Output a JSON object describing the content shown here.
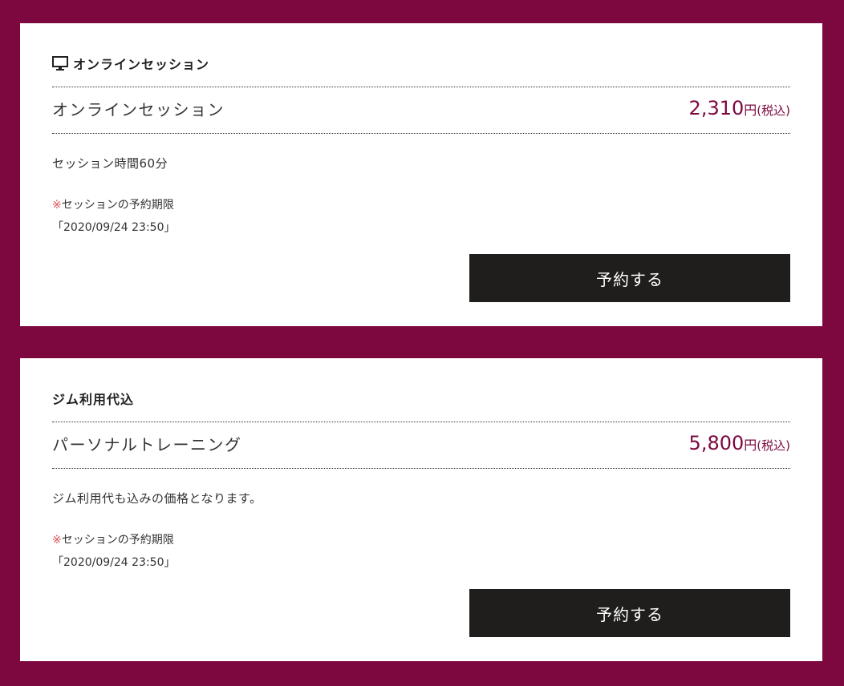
{
  "colors": {
    "background": "#7d0840",
    "card": "#ffffff",
    "price": "#7d0840",
    "button": "#1f1e1c",
    "button_text": "#ffffff",
    "note_mark": "#d9535a"
  },
  "plans": [
    {
      "category_icon": "monitor-icon",
      "category": "オンラインセッション",
      "name": "オンラインセッション",
      "price": "2,310",
      "currency": "円",
      "tax_note": "(税込)",
      "description": "セッション時間60分",
      "deadline_mark": "※",
      "deadline_label": "セッションの予約期限",
      "deadline_value": "「2020/09/24 23:50」",
      "button_label": "予約する"
    },
    {
      "category_icon": "",
      "category": "ジム利用代込",
      "name": "パーソナルトレーニング",
      "price": "5,800",
      "currency": "円",
      "tax_note": "(税込)",
      "description": "ジム利用代も込みの価格となります。",
      "deadline_mark": "※",
      "deadline_label": "セッションの予約期限",
      "deadline_value": "「2020/09/24 23:50」",
      "button_label": "予約する"
    }
  ]
}
